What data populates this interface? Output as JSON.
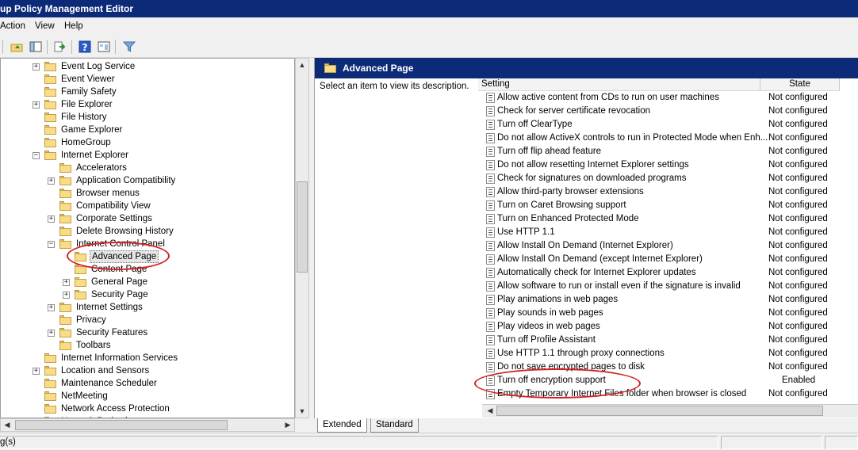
{
  "window": {
    "title": "up Policy Management Editor"
  },
  "menu": {
    "items": [
      "Action",
      "View",
      "Help"
    ]
  },
  "tree": {
    "items": [
      {
        "label": "Event Log Service",
        "expander": "+"
      },
      {
        "label": "Event Viewer",
        "expander": ""
      },
      {
        "label": "Family Safety",
        "expander": ""
      },
      {
        "label": "File Explorer",
        "expander": "+"
      },
      {
        "label": "File History",
        "expander": ""
      },
      {
        "label": "Game Explorer",
        "expander": ""
      },
      {
        "label": "HomeGroup",
        "expander": ""
      },
      {
        "label": "Internet Explorer",
        "expander": "−"
      },
      {
        "label": "Accelerators",
        "expander": ""
      },
      {
        "label": "Application Compatibility",
        "expander": "+"
      },
      {
        "label": "Browser menus",
        "expander": ""
      },
      {
        "label": "Compatibility View",
        "expander": ""
      },
      {
        "label": "Corporate Settings",
        "expander": "+"
      },
      {
        "label": "Delete Browsing History",
        "expander": ""
      },
      {
        "label": "Internet Control Panel",
        "expander": "−"
      },
      {
        "label": "Advanced Page",
        "expander": ""
      },
      {
        "label": "Content Page",
        "expander": ""
      },
      {
        "label": "General Page",
        "expander": "+"
      },
      {
        "label": "Security Page",
        "expander": "+"
      },
      {
        "label": "Internet Settings",
        "expander": "+"
      },
      {
        "label": "Privacy",
        "expander": ""
      },
      {
        "label": "Security Features",
        "expander": "+"
      },
      {
        "label": "Toolbars",
        "expander": ""
      },
      {
        "label": "Internet Information Services",
        "expander": ""
      },
      {
        "label": "Location and Sensors",
        "expander": "+"
      },
      {
        "label": "Maintenance Scheduler",
        "expander": ""
      },
      {
        "label": "NetMeeting",
        "expander": ""
      },
      {
        "label": "Network Access Protection",
        "expander": ""
      },
      {
        "label": "Network Projection",
        "expander": ""
      }
    ]
  },
  "right_pane": {
    "header_title": "Advanced Page",
    "description": "Select an item to view its description.",
    "columns": {
      "setting": "Setting",
      "state": "State"
    },
    "rows": [
      {
        "setting": "Allow active content from CDs to run on user machines",
        "state": "Not configured"
      },
      {
        "setting": "Check for server certificate revocation",
        "state": "Not configured"
      },
      {
        "setting": "Turn off ClearType",
        "state": "Not configured"
      },
      {
        "setting": "Do not allow ActiveX controls to run in Protected Mode when Enh...",
        "state": "Not configured"
      },
      {
        "setting": "Turn off flip ahead feature",
        "state": "Not configured"
      },
      {
        "setting": "Do not allow resetting Internet Explorer settings",
        "state": "Not configured"
      },
      {
        "setting": "Check for signatures on downloaded programs",
        "state": "Not configured"
      },
      {
        "setting": "Allow third-party browser extensions",
        "state": "Not configured"
      },
      {
        "setting": "Turn on Caret Browsing support",
        "state": "Not configured"
      },
      {
        "setting": "Turn on Enhanced Protected Mode",
        "state": "Not configured"
      },
      {
        "setting": "Use HTTP 1.1",
        "state": "Not configured"
      },
      {
        "setting": "Allow Install On Demand (Internet Explorer)",
        "state": "Not configured"
      },
      {
        "setting": "Allow Install On Demand (except Internet Explorer)",
        "state": "Not configured"
      },
      {
        "setting": "Automatically check for Internet Explorer updates",
        "state": "Not configured"
      },
      {
        "setting": "Allow software to run or install even if the signature is invalid",
        "state": "Not configured"
      },
      {
        "setting": "Play animations in web pages",
        "state": "Not configured"
      },
      {
        "setting": "Play sounds in web pages",
        "state": "Not configured"
      },
      {
        "setting": "Play videos in web pages",
        "state": "Not configured"
      },
      {
        "setting": "Turn off Profile Assistant",
        "state": "Not configured"
      },
      {
        "setting": "Use HTTP 1.1 through proxy connections",
        "state": "Not configured"
      },
      {
        "setting": "Do not save encrypted pages to disk",
        "state": "Not configured"
      },
      {
        "setting": "Turn off encryption support",
        "state": "Enabled"
      },
      {
        "setting": "Empty Temporary Internet Files folder when browser is closed",
        "state": "Not configured"
      }
    ]
  },
  "tabs": [
    "Extended",
    "Standard"
  ],
  "status": {
    "text": "g(s)"
  },
  "colors": {
    "titlebar": "#0c2a78",
    "annotation": "#d42020"
  }
}
